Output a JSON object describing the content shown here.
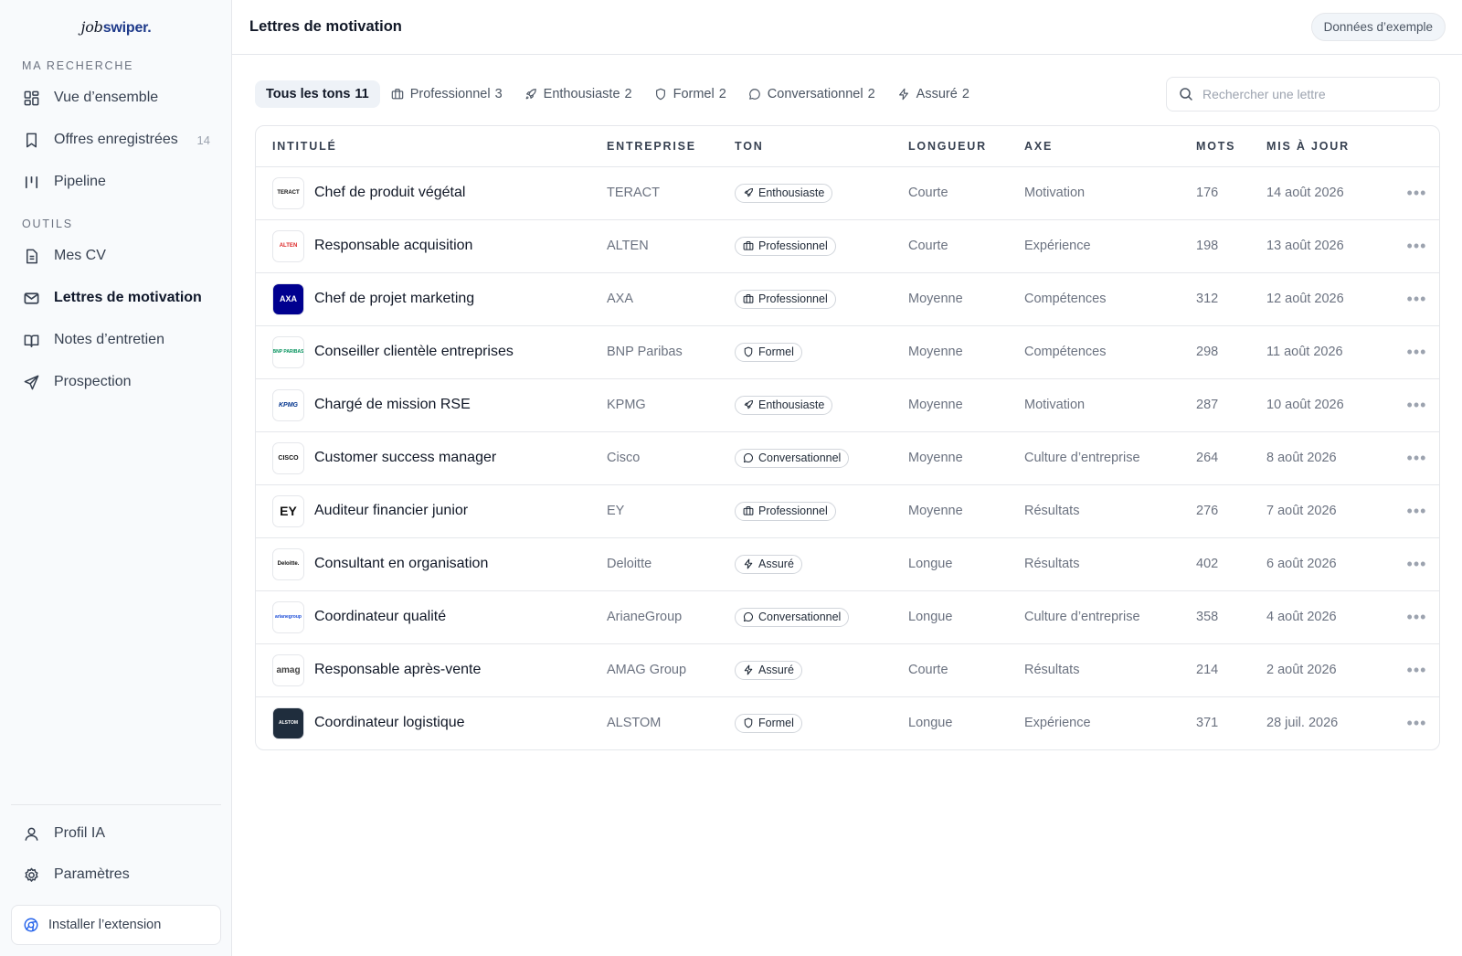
{
  "sidebar": {
    "logo_job": "job",
    "logo_swiper": "swiper.",
    "section_search": "MA RECHERCHE",
    "section_tools": "OUTILS",
    "items": [
      {
        "label": "Vue d’ensemble",
        "icon": "grid-icon"
      },
      {
        "label": "Offres enregistrées",
        "icon": "bookmark-icon",
        "count": "14"
      },
      {
        "label": "Pipeline",
        "icon": "pipeline-icon"
      },
      {
        "label": "Mes CV",
        "icon": "document-icon"
      },
      {
        "label": "Lettres de motivation",
        "icon": "mail-icon",
        "active": true
      },
      {
        "label": "Notes d’entretien",
        "icon": "book-icon"
      },
      {
        "label": "Prospection",
        "icon": "send-icon"
      },
      {
        "label": "Profil IA",
        "icon": "user-icon"
      },
      {
        "label": "Paramètres",
        "icon": "gear-icon"
      }
    ],
    "install_label": "Installer l’extension"
  },
  "header": {
    "title": "Lettres de motivation",
    "demo_badge": "Données d’exemple"
  },
  "filters": [
    {
      "label": "Tous les tons",
      "count": "11",
      "active": true
    },
    {
      "label": "Professionnel",
      "count": "3",
      "icon": "briefcase-icon"
    },
    {
      "label": "Enthousiaste",
      "count": "2",
      "icon": "rocket-icon"
    },
    {
      "label": "Formel",
      "count": "2",
      "icon": "shield-icon"
    },
    {
      "label": "Conversationnel",
      "count": "2",
      "icon": "chat-icon"
    },
    {
      "label": "Assuré",
      "count": "2",
      "icon": "bolt-icon"
    }
  ],
  "search": {
    "placeholder": "Rechercher une lettre"
  },
  "table": {
    "headers": [
      "INTITULÉ",
      "ENTREPRISE",
      "TON",
      "LONGUEUR",
      "AXE",
      "MOTS",
      "MIS À JOUR"
    ],
    "rows": [
      {
        "title": "Chef de produit végétal",
        "company": "TERACT",
        "logo": "TERACT",
        "tone": "Enthousiaste",
        "tone_icon": "rocket-icon",
        "length": "Courte",
        "axis": "Motivation",
        "words": "176",
        "updated": "14 août 2026"
      },
      {
        "title": "Responsable acquisition",
        "company": "ALTEN",
        "logo": "ALTEN",
        "tone": "Professionnel",
        "tone_icon": "briefcase-icon",
        "length": "Courte",
        "axis": "Expérience",
        "words": "198",
        "updated": "13 août 2026"
      },
      {
        "title": "Chef de projet marketing",
        "company": "AXA",
        "logo": "AXA",
        "tone": "Professionnel",
        "tone_icon": "briefcase-icon",
        "length": "Moyenne",
        "axis": "Compétences",
        "words": "312",
        "updated": "12 août 2026"
      },
      {
        "title": "Conseiller clientèle entreprises",
        "company": "BNP Paribas",
        "logo": "BNP PARIBAS",
        "tone": "Formel",
        "tone_icon": "shield-icon",
        "length": "Moyenne",
        "axis": "Compétences",
        "words": "298",
        "updated": "11 août 2026"
      },
      {
        "title": "Chargé de mission RSE",
        "company": "KPMG",
        "logo": "KPMG",
        "tone": "Enthousiaste",
        "tone_icon": "rocket-icon",
        "length": "Moyenne",
        "axis": "Motivation",
        "words": "287",
        "updated": "10 août 2026"
      },
      {
        "title": "Customer success manager",
        "company": "Cisco",
        "logo": "CISCO",
        "tone": "Conversationnel",
        "tone_icon": "chat-icon",
        "length": "Moyenne",
        "axis": "Culture d’entreprise",
        "words": "264",
        "updated": "8 août 2026"
      },
      {
        "title": "Auditeur financier junior",
        "company": "EY",
        "logo": "EY",
        "tone": "Professionnel",
        "tone_icon": "briefcase-icon",
        "length": "Moyenne",
        "axis": "Résultats",
        "words": "276",
        "updated": "7 août 2026"
      },
      {
        "title": "Consultant en organisation",
        "company": "Deloitte",
        "logo": "Deloitte.",
        "tone": "Assuré",
        "tone_icon": "bolt-icon",
        "length": "Longue",
        "axis": "Résultats",
        "words": "402",
        "updated": "6 août 2026"
      },
      {
        "title": "Coordinateur qualité",
        "company": "ArianeGroup",
        "logo": "arianegroup",
        "tone": "Conversationnel",
        "tone_icon": "chat-icon",
        "length": "Longue",
        "axis": "Culture d’entreprise",
        "words": "358",
        "updated": "4 août 2026"
      },
      {
        "title": "Responsable après-vente",
        "company": "AMAG Group",
        "logo": "amag",
        "tone": "Assuré",
        "tone_icon": "bolt-icon",
        "length": "Courte",
        "axis": "Résultats",
        "words": "214",
        "updated": "2 août 2026"
      },
      {
        "title": "Coordinateur logistique",
        "company": "ALSTOM",
        "logo": "ALSTOM",
        "tone": "Formel",
        "tone_icon": "shield-icon",
        "length": "Longue",
        "axis": "Expérience",
        "words": "371",
        "updated": "28 juil. 2026"
      }
    ]
  },
  "colors": {
    "accent": "#1e3a8a",
    "sidebar_bg": "#f8fafc",
    "border": "#e5e7eb"
  }
}
